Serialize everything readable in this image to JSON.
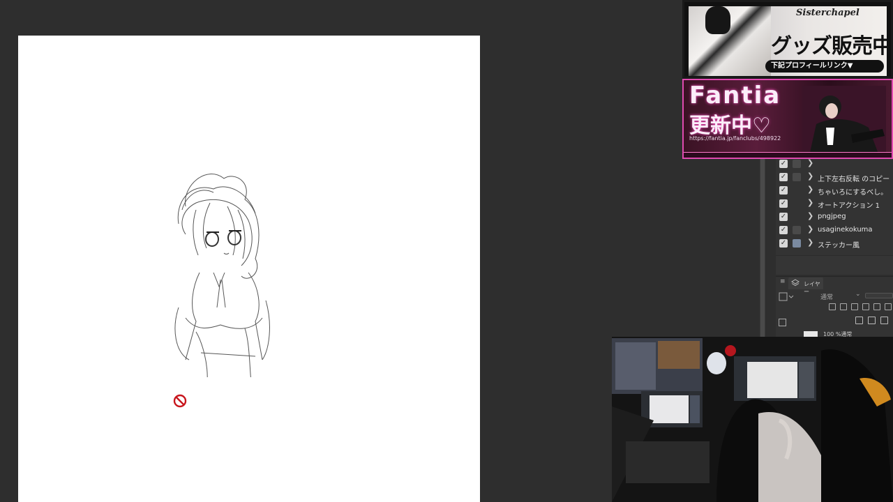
{
  "auto_action_panel": {
    "rows": [
      {
        "label": "",
        "checked": true,
        "partial": true
      },
      {
        "label": "上下左右反転 のコピー",
        "checked": true
      },
      {
        "label": "ちゃいろにするべし。",
        "checked": true
      },
      {
        "label": "オートアクション 1",
        "checked": true
      },
      {
        "label": "pngjpeg",
        "checked": true
      },
      {
        "label": "usaginekokuma",
        "checked": true
      },
      {
        "label": "ステッカー風",
        "checked": true
      }
    ],
    "check_glyph": "✓",
    "arrow_glyph": "❯"
  },
  "layer_panel": {
    "menu_glyph": "≡",
    "tab_label": "レイヤー",
    "blend_mode": "通常",
    "blend_dropdown": "⌄",
    "layer_row_label": "100 %通常"
  },
  "ads": {
    "top": {
      "brand": "Sisterchapel",
      "headline": "グッズ販売中",
      "sub": "下記プロフィールリンク▼"
    },
    "bottom": {
      "title": "Fantia",
      "subtitle": "更新中♡",
      "url": "https://fantia.jp/fanclubs/498922"
    }
  },
  "colors": {
    "background": "#2e2e2e",
    "canvas": "#ffffff",
    "panel": "#333333",
    "fantia_accent": "#e04ab0",
    "no_icon": "#c8161d"
  },
  "icons": {
    "cursor": "no-entry-icon",
    "layer_tab": "layers-icon"
  }
}
